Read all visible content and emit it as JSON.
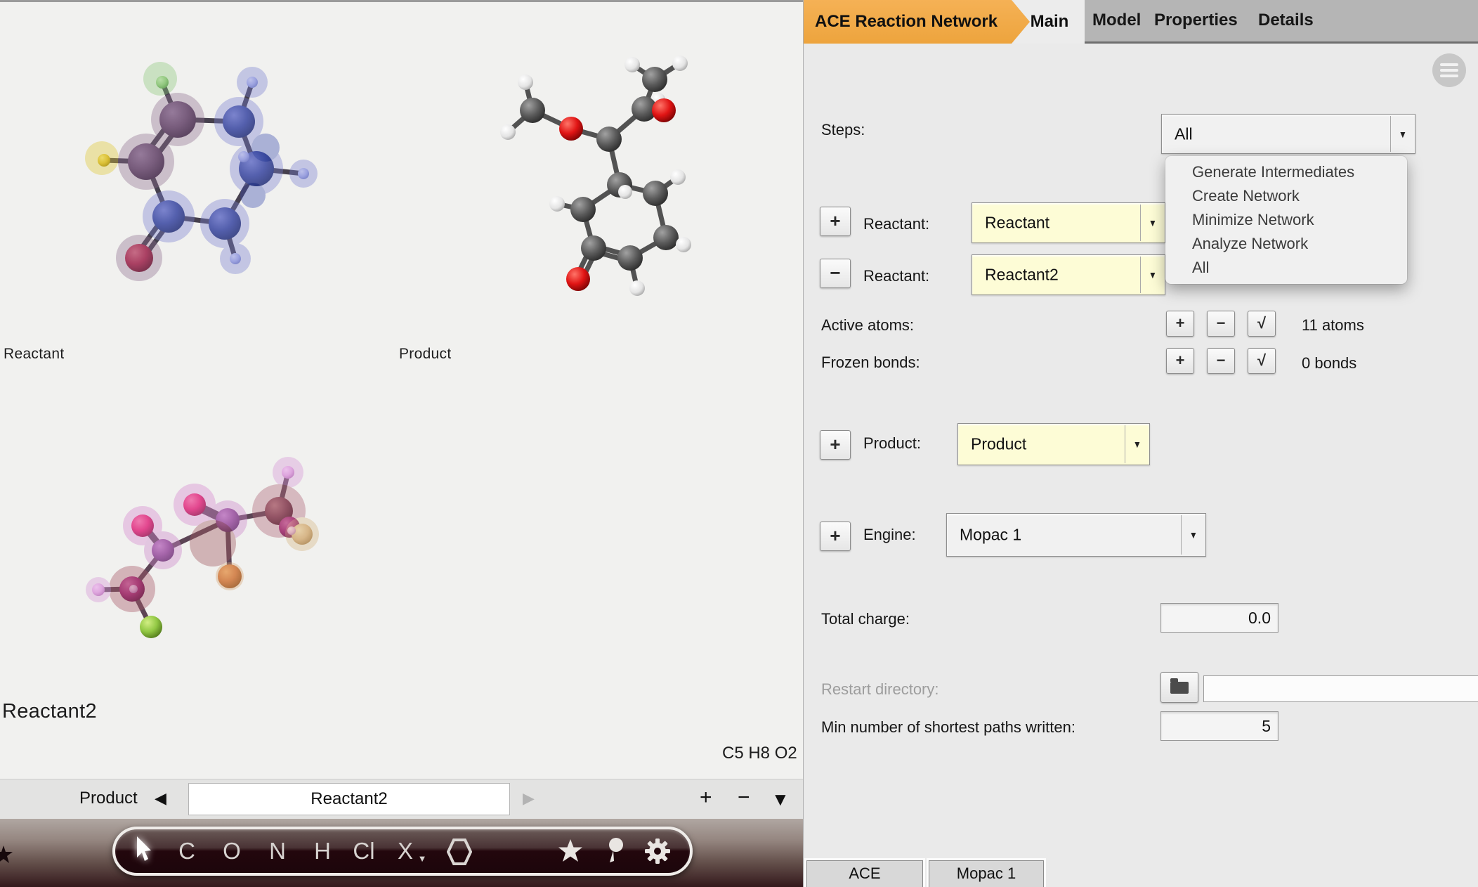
{
  "panel": {
    "title": "ACE Reaction Network",
    "tabs": [
      "Main",
      "Model",
      "Properties",
      "Details"
    ],
    "glyphs": {
      "plus": "+",
      "minus": "−",
      "check": "√",
      "dropdown": "▼"
    },
    "steps": {
      "label": "Steps:",
      "value": "All",
      "options": [
        "Generate Intermediates",
        "Create Network",
        "Minimize Network",
        "Analyze Network",
        "All"
      ]
    },
    "reactant1": {
      "label": "Reactant:",
      "value": "Reactant"
    },
    "reactant2": {
      "label": "Reactant:",
      "value": "Reactant2"
    },
    "active_atoms": {
      "label": "Active atoms:",
      "count": "11 atoms"
    },
    "frozen_bonds": {
      "label": "Frozen bonds:",
      "count": "0 bonds"
    },
    "product": {
      "label": "Product:",
      "value": "Product"
    },
    "engine": {
      "label": "Engine:",
      "value": "Mopac 1"
    },
    "total_charge": {
      "label": "Total charge:",
      "value": "0.0"
    },
    "restart": {
      "label": "Restart directory:",
      "value": ""
    },
    "min_paths": {
      "label": "Min number of shortest paths written:",
      "value": "5"
    },
    "bottom_tabs": [
      "ACE",
      "Mopac 1"
    ]
  },
  "viewer": {
    "labels": {
      "reactant": "Reactant",
      "product": "Product",
      "reactant2": "Reactant2"
    },
    "formula": "C5 H8 O2",
    "nav": {
      "prev_label": "Product",
      "prev_arrow": "◀",
      "field_value": "Reactant2",
      "next_arrow": "▶",
      "zoom_in": "+",
      "zoom_out": "−",
      "menu_down": "▼"
    },
    "toolbar": {
      "elements": [
        "C",
        "O",
        "N",
        "H",
        "Cl",
        "X"
      ],
      "x_caret": "▼"
    }
  },
  "colors": {
    "accent_orange": "#eda43d",
    "combo_yellow": "#fdfcd6",
    "panel_bg": "#eaeaea",
    "viewer_bg": "#f1f1ef",
    "toolbar_dark": "#23070d"
  }
}
